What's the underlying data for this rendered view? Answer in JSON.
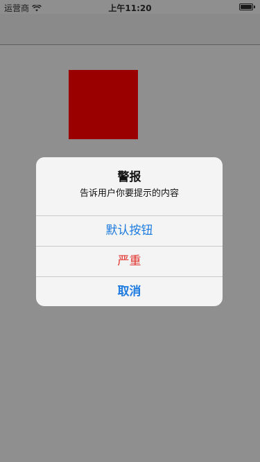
{
  "status_bar": {
    "carrier": "运营商",
    "time": "上午11:20",
    "wifi_icon": "wifi-icon",
    "battery_icon": "battery-icon",
    "battery_level": 1.0
  },
  "alert": {
    "title": "警报",
    "message": "告诉用户你要提示的内容",
    "buttons": [
      {
        "label": "默认按钮",
        "style": "default",
        "color": "#1d7be0"
      },
      {
        "label": "严重",
        "style": "destructive",
        "color": "#e0312a"
      },
      {
        "label": "取消",
        "style": "cancel",
        "color": "#1d7be0"
      }
    ]
  },
  "colors": {
    "overlay_background": "#8f8f8f",
    "square": "#9a0000",
    "alert_background": "#f4f4f4"
  }
}
